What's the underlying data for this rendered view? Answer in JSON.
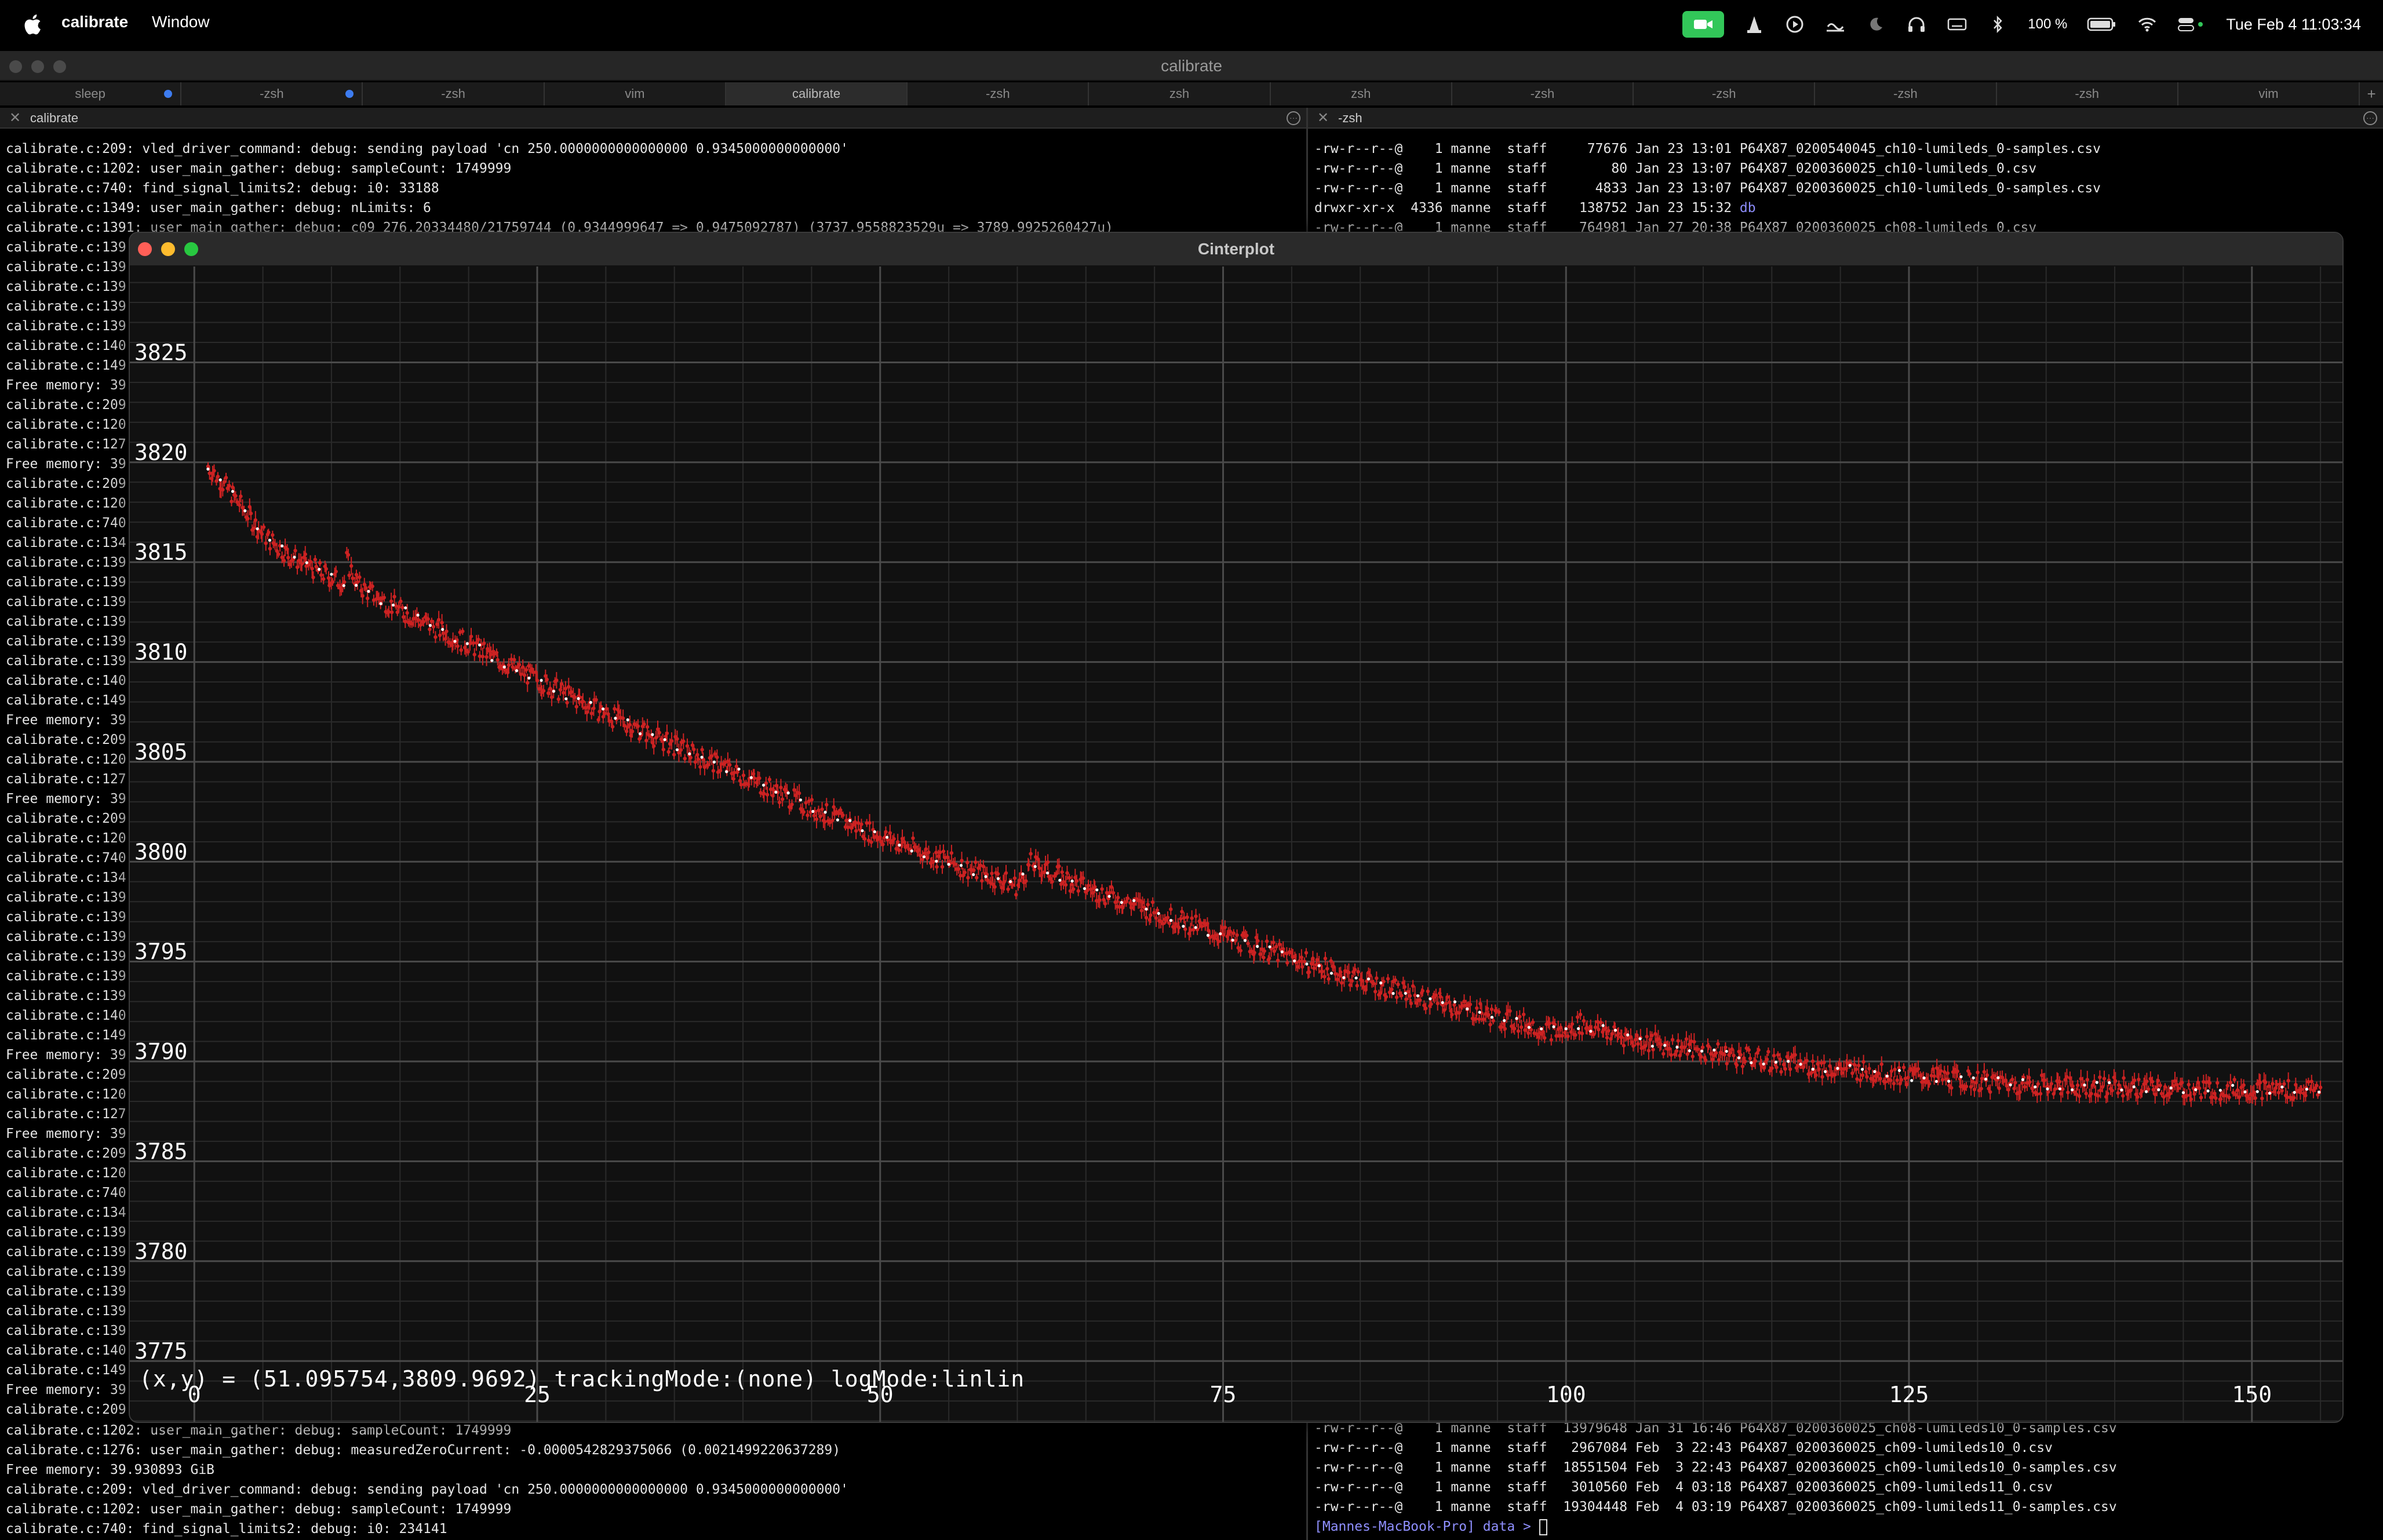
{
  "menubar": {
    "app_name": "calibrate",
    "menu_window": "Window",
    "battery": "100 %",
    "datetime": "Tue Feb 4  11:03:34",
    "icons": [
      "facetime-record-icon",
      "vlc-cone-icon",
      "play-icon",
      "screen-share-icon",
      "moon-icon",
      "headphones-icon",
      "keyboard-icon",
      "bluetooth-icon",
      "battery-icon",
      "wifi-icon",
      "control-center-icon"
    ]
  },
  "terminal": {
    "title": "calibrate",
    "tabs": [
      {
        "label": "sleep",
        "dot": true
      },
      {
        "label": "-zsh",
        "dot": true
      },
      {
        "label": "-zsh",
        "dot": false
      },
      {
        "label": "vim",
        "dot": false
      },
      {
        "label": "calibrate",
        "dot": false,
        "active": true
      },
      {
        "label": "-zsh",
        "dot": false
      },
      {
        "label": "zsh",
        "dot": false
      },
      {
        "label": "zsh",
        "dot": false
      },
      {
        "label": "-zsh",
        "dot": false
      },
      {
        "label": "-zsh",
        "dot": false
      },
      {
        "label": "-zsh",
        "dot": false
      },
      {
        "label": "-zsh",
        "dot": false
      },
      {
        "label": "vim",
        "dot": false
      }
    ],
    "new_tab": "+",
    "left_pane": {
      "name": "calibrate",
      "top_lines": [
        "calibrate.c:209: vled_driver_command: debug: sending payload 'cn 250.0000000000000000 0.9345000000000000'",
        "calibrate.c:1202: user_main_gather: debug: sampleCount: 1749999",
        "calibrate.c:740: find_signal_limits2: debug: i0: 33188",
        "calibrate.c:1349: user_main_gather: debug: nLimits: 6",
        "calibrate.c:1391: user_main_gather: debug: c09 276.20334480/21759744 (0.9344999647 => 0.9475092787) (3737.9558823529u => 3789.9925260427u)"
      ],
      "side_lines": [
        "calibrate.c:139",
        "calibrate.c:139",
        "calibrate.c:139",
        "calibrate.c:139",
        "calibrate.c:139",
        "calibrate.c:140",
        "calibrate.c:149",
        "Free memory: 39",
        "calibrate.c:209",
        "calibrate.c:120",
        "calibrate.c:127",
        "Free memory: 39",
        "calibrate.c:209",
        "calibrate.c:120",
        "calibrate.c:740",
        "calibrate.c:134",
        "calibrate.c:139",
        "calibrate.c:139",
        "calibrate.c:139",
        "calibrate.c:139",
        "calibrate.c:139",
        "calibrate.c:139",
        "calibrate.c:140",
        "calibrate.c:149",
        "Free memory: 39",
        "calibrate.c:209",
        "calibrate.c:120",
        "calibrate.c:127",
        "Free memory: 39",
        "calibrate.c:209",
        "calibrate.c:120",
        "calibrate.c:740",
        "calibrate.c:134",
        "calibrate.c:139",
        "calibrate.c:139",
        "calibrate.c:139",
        "calibrate.c:139",
        "calibrate.c:139",
        "calibrate.c:139",
        "calibrate.c:140",
        "calibrate.c:149",
        "Free memory: 39",
        "calibrate.c:209",
        "calibrate.c:120",
        "calibrate.c:127",
        "Free memory: 39",
        "calibrate.c:209",
        "calibrate.c:120",
        "calibrate.c:740",
        "calibrate.c:134",
        "calibrate.c:139",
        "calibrate.c:139",
        "calibrate.c:139",
        "calibrate.c:139",
        "calibrate.c:139",
        "calibrate.c:139",
        "calibrate.c:140",
        "calibrate.c:149",
        "Free memory: 39",
        "calibrate.c:209"
      ],
      "bottom_lines": [
        "calibrate.c:1202: user_main_gather: debug: sampleCount: 1749999",
        "calibrate.c:1276: user_main_gather: debug: measuredZeroCurrent: -0.0000542829375066 (0.0021499220637289)",
        "Free memory: 39.930893 GiB",
        "calibrate.c:209: vled_driver_command: debug: sending payload 'cn 250.0000000000000000 0.9345000000000000'",
        "calibrate.c:1202: user_main_gather: debug: sampleCount: 1749999",
        "calibrate.c:740: find_signal_limits2: debug: i0: 234141"
      ]
    },
    "right_pane": {
      "name": "-zsh",
      "top_lines": [
        "-rw-r--r--@    1 manne  staff     77676 Jan 23 13:01 P64X87_0200540045_ch10-lumileds_0-samples.csv",
        "-rw-r--r--@    1 manne  staff        80 Jan 23 13:07 P64X87_0200360025_ch10-lumileds_0.csv",
        "-rw-r--r--@    1 manne  staff      4833 Jan 23 13:07 P64X87_0200360025_ch10-lumileds_0-samples.csv",
        "drwxr-xr-x  4336 manne  staff    138752 Jan 23 15:32 db",
        "-rw-r--r--@    1 manne  staff    764981 Jan 27 20:38 P64X87_0200360025_ch08-lumileds_0.csv"
      ],
      "bottom_lines": [
        "-rw-r--r--@    1 manne  staff  13979648 Jan 31 16:46 P64X87_0200360025_ch08-lumileds10_0-samples.csv",
        "-rw-r--r--@    1 manne  staff   2967084 Feb  3 22:43 P64X87_0200360025_ch09-lumileds10_0.csv",
        "-rw-r--r--@    1 manne  staff  18551504 Feb  3 22:43 P64X87_0200360025_ch09-lumileds10_0-samples.csv",
        "-rw-r--r--@    1 manne  staff   3010560 Feb  4 03:18 P64X87_0200360025_ch09-lumileds11_0.csv",
        "-rw-r--r--@    1 manne  staff  19304448 Feb  4 03:19 P64X87_0200360025_ch09-lumileds11_0-samples.csv"
      ],
      "prompt": "[Mannes-MacBook-Pro] data > ",
      "dir_color": "#8f8fff"
    }
  },
  "plot_window": {
    "title": "Cinterplot",
    "readout": "(x,y) = (51.095754,3809.9692) trackingMode:(none) logMode:linlin"
  },
  "chart_data": {
    "type": "scatter",
    "xlim": [
      -4.7,
      156.6
    ],
    "ylim": [
      3771.9,
      3829.8
    ],
    "xticks": [
      0,
      25,
      50,
      75,
      100,
      125,
      150
    ],
    "yticks": [
      3775,
      3780,
      3785,
      3790,
      3795,
      3800,
      3805,
      3810,
      3815,
      3820,
      3825
    ],
    "grid": true,
    "point_color": "#cc2222",
    "center_color": "#ffffff",
    "x": [
      1,
      3,
      5,
      7,
      10,
      12,
      15,
      20,
      25,
      30,
      35,
      40,
      45,
      50,
      55,
      60,
      61,
      65,
      70,
      75,
      80,
      85,
      90,
      95,
      100,
      101,
      105,
      110,
      115,
      120,
      125,
      130,
      135,
      140,
      145,
      150,
      155
    ],
    "y": [
      3819.8,
      3818.2,
      3816.4,
      3815.3,
      3814.2,
      3813.8,
      3812.6,
      3810.9,
      3809.1,
      3807.4,
      3805.8,
      3804.3,
      3802.7,
      3801.3,
      3800.0,
      3798.8,
      3799.9,
      3798.7,
      3797.5,
      3796.3,
      3795.2,
      3794.1,
      3793.1,
      3792.2,
      3791.4,
      3791.9,
      3791.1,
      3790.5,
      3790.0,
      3789.6,
      3789.3,
      3789.0,
      3788.8,
      3788.7,
      3788.6,
      3788.6,
      3788.6
    ]
  }
}
